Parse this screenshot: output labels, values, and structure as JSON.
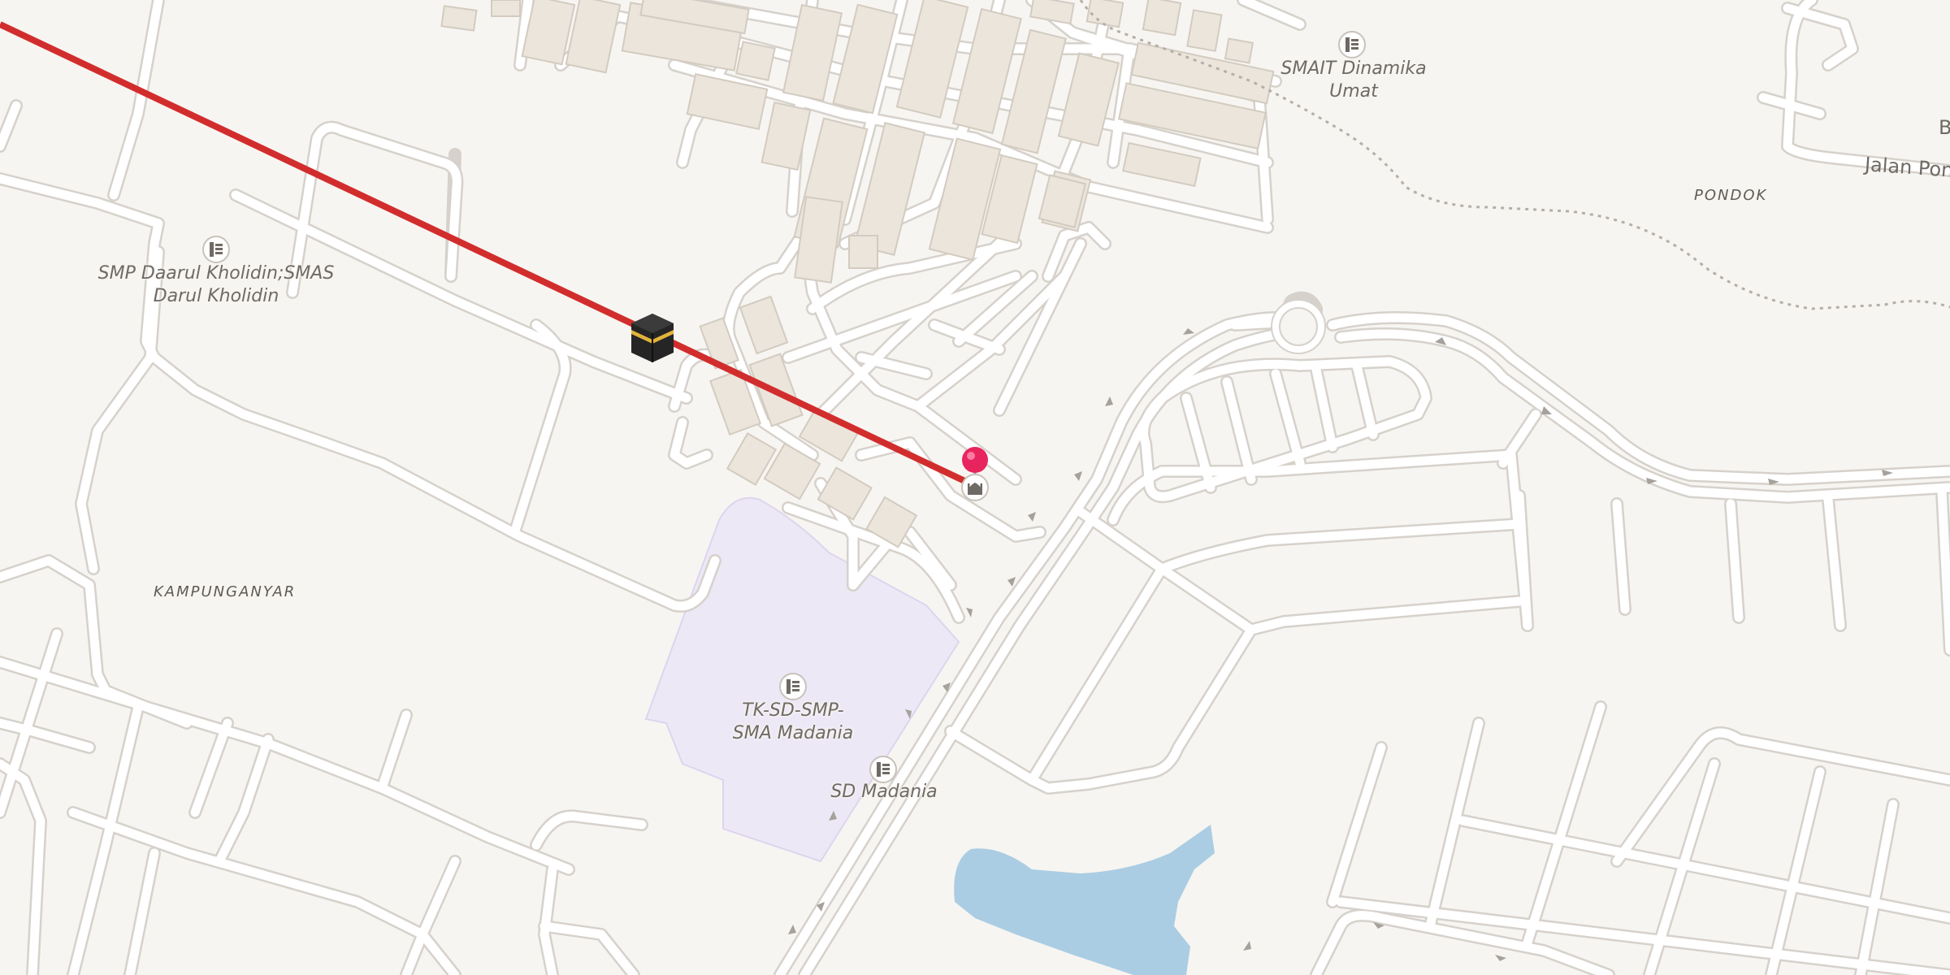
{
  "map": {
    "colors": {
      "background": "#f7f5f1",
      "road": "#ffffff",
      "road_casing": "#d6d1cb",
      "building": "#ebe5dc",
      "building_outline": "#d3cbc0",
      "school_area": "#ede8f6",
      "water": "#aacde3",
      "qibla_line": "#d22d2d",
      "pin": "#e8245f"
    },
    "labels": {
      "smp_daarul": "SMP Daarul Kholidin;SMAS\nDarul Kholidin",
      "smait": "SMAIT Dinamika\nUmat",
      "tk_madania": "TK-SD-SMP-\nSMA Madania",
      "sd_madania": "SD Madania",
      "kampunganyar": "KAMPUNGANYAR",
      "pondok": "PONDOK",
      "jalan": "Jalan Pon",
      "edge_b": "B"
    },
    "icons": {
      "school": "school-icon",
      "mosque": "mosque-icon",
      "kaaba": "kaaba-icon",
      "pin": "location-pin-icon"
    }
  }
}
